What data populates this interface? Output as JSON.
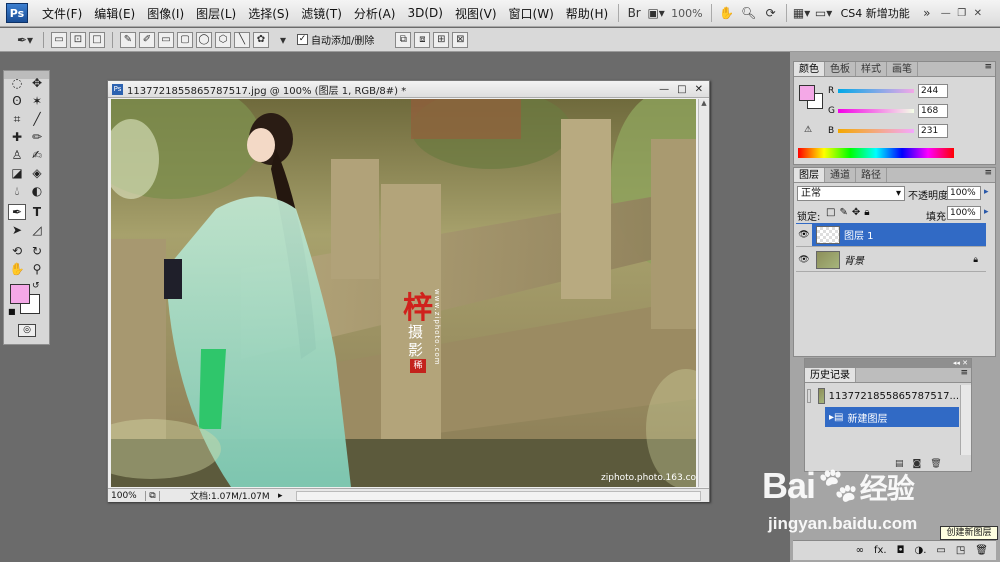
{
  "menubar": {
    "logo": "Ps",
    "items": [
      "文件(F)",
      "编辑(E)",
      "图像(I)",
      "图层(L)",
      "选择(S)",
      "滤镜(T)",
      "分析(A)",
      "3D(D)",
      "视图(V)",
      "窗口(W)",
      "帮助(H)"
    ],
    "zoom": "100%",
    "workspace": "CS4 新增功能",
    "icons": [
      "bridge-icon",
      "screen-mode-icon",
      "zoom-icon",
      "hand-icon",
      "magnifier-icon",
      "rotate-view-icon",
      "arrange-icon",
      "screen-icon"
    ]
  },
  "options": {
    "auto_add_delete": "自动添加/删除",
    "auto_add_checked": "✓"
  },
  "document": {
    "title": "1137721855865787517.jpg @ 100% (图层 1, RGB/8#) *",
    "zoom": "100%",
    "doc_size": "文档:1.07M/1.07M",
    "credit": "ziphoto.photo.163.com",
    "vertical_text": "www.ziphoto.com",
    "stamp_char_1": "梓",
    "stamp_char_2": "摄",
    "stamp_char_3": "影",
    "stamp_seal": "稀"
  },
  "color_panel": {
    "tabs": [
      "颜色",
      "色板",
      "样式",
      "画笔"
    ],
    "r_label": "R",
    "g_label": "G",
    "b_label": "B",
    "r": "244",
    "g": "168",
    "b": "231",
    "foreground": "#f4a8e7"
  },
  "layers_panel": {
    "tabs": [
      "图层",
      "通道",
      "路径"
    ],
    "blend_mode": "正常",
    "opacity_label": "不透明度:",
    "opacity": "100%",
    "lock_label": "锁定:",
    "fill_label": "填充:",
    "fill": "100%",
    "layers": [
      {
        "name": "图层 1",
        "selected": true
      },
      {
        "name": "背景",
        "selected": false
      }
    ]
  },
  "history_panel": {
    "title": "历史记录",
    "items": [
      "1137721855865787517...",
      "新建图层"
    ]
  },
  "tooltip": "创建新图层",
  "baidu": {
    "logo_text": "Bai",
    "logo_text2": "经验",
    "url": "jingyan.baidu.com"
  }
}
